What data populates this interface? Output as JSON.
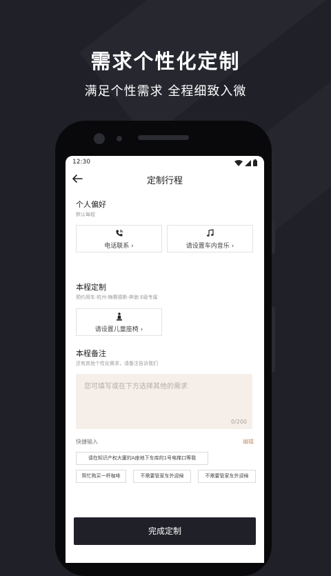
{
  "promo": {
    "title": "需求个性化定制",
    "subtitle": "满足个性需求 全程细致入微"
  },
  "status_bar": {
    "time": "12:30",
    "icons": [
      "wifi-icon",
      "signal-icon",
      "battery-icon"
    ]
  },
  "nav": {
    "back_icon": "arrow-left-icon",
    "title": "定制行程"
  },
  "personal": {
    "title": "个人偏好",
    "subtitle": "默认每程",
    "cards": [
      {
        "icon": "phone-icon",
        "label": "电话联系 ›"
      },
      {
        "icon": "music-note-icon",
        "label": "请设置车内音乐 ›"
      }
    ]
  },
  "trip": {
    "title": "本程定制",
    "subtitle": "预约用车·杭州·梅赛德斯-奔驰 E级专属",
    "cards": [
      {
        "icon": "child-seat-icon",
        "label": "请设置儿童座椅 ›"
      }
    ]
  },
  "notes": {
    "title": "本程备注",
    "subtitle": "还有其他个性化需求，请备注告诉我们",
    "placeholder": "您可填写或在下方选择其他的需求",
    "counter": "0/200"
  },
  "quick_input": {
    "label": "快捷输入",
    "edit": "编辑",
    "chips": [
      "请在知识产权大厦的A座地下车库的1号电梯口等我",
      "帮忙购买一杯咖啡",
      "不需要管家车外迎候",
      "不需要管家车外迎候"
    ]
  },
  "submit_button": "完成定制",
  "colors": {
    "background": "#1f2028",
    "note_box": "#f6efe9",
    "accent": "#c4956e"
  }
}
